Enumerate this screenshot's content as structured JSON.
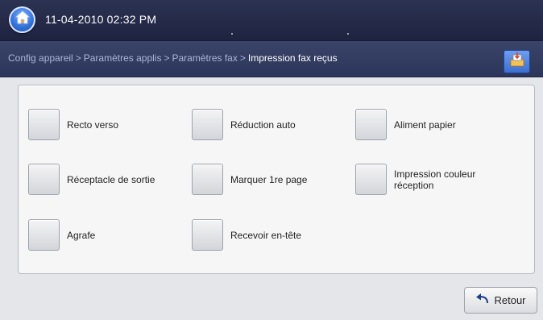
{
  "header": {
    "datetime": "11-04-2010 02:32 PM",
    "home_icon": "home-icon"
  },
  "breadcrumb": {
    "items": [
      "Config appareil",
      "Paramètres applis",
      "Paramètres fax"
    ],
    "separator": ">",
    "current": "Impression fax reçus",
    "job_icon": "job-status-icon"
  },
  "options": [
    {
      "label": "Recto verso"
    },
    {
      "label": "Réduction auto"
    },
    {
      "label": "Aliment papier"
    },
    {
      "label": "Réceptacle de sortie"
    },
    {
      "label": "Marquer 1re page"
    },
    {
      "label": "Impression couleur réception"
    },
    {
      "label": "Agrafe"
    },
    {
      "label": "Recevoir en-tête"
    }
  ],
  "footer": {
    "back_label": "Retour",
    "back_icon": "undo-arrow-icon"
  },
  "colors": {
    "topbar": "#2c3252",
    "crumbbar": "#3a4468",
    "accent": "#3b6fd0"
  }
}
